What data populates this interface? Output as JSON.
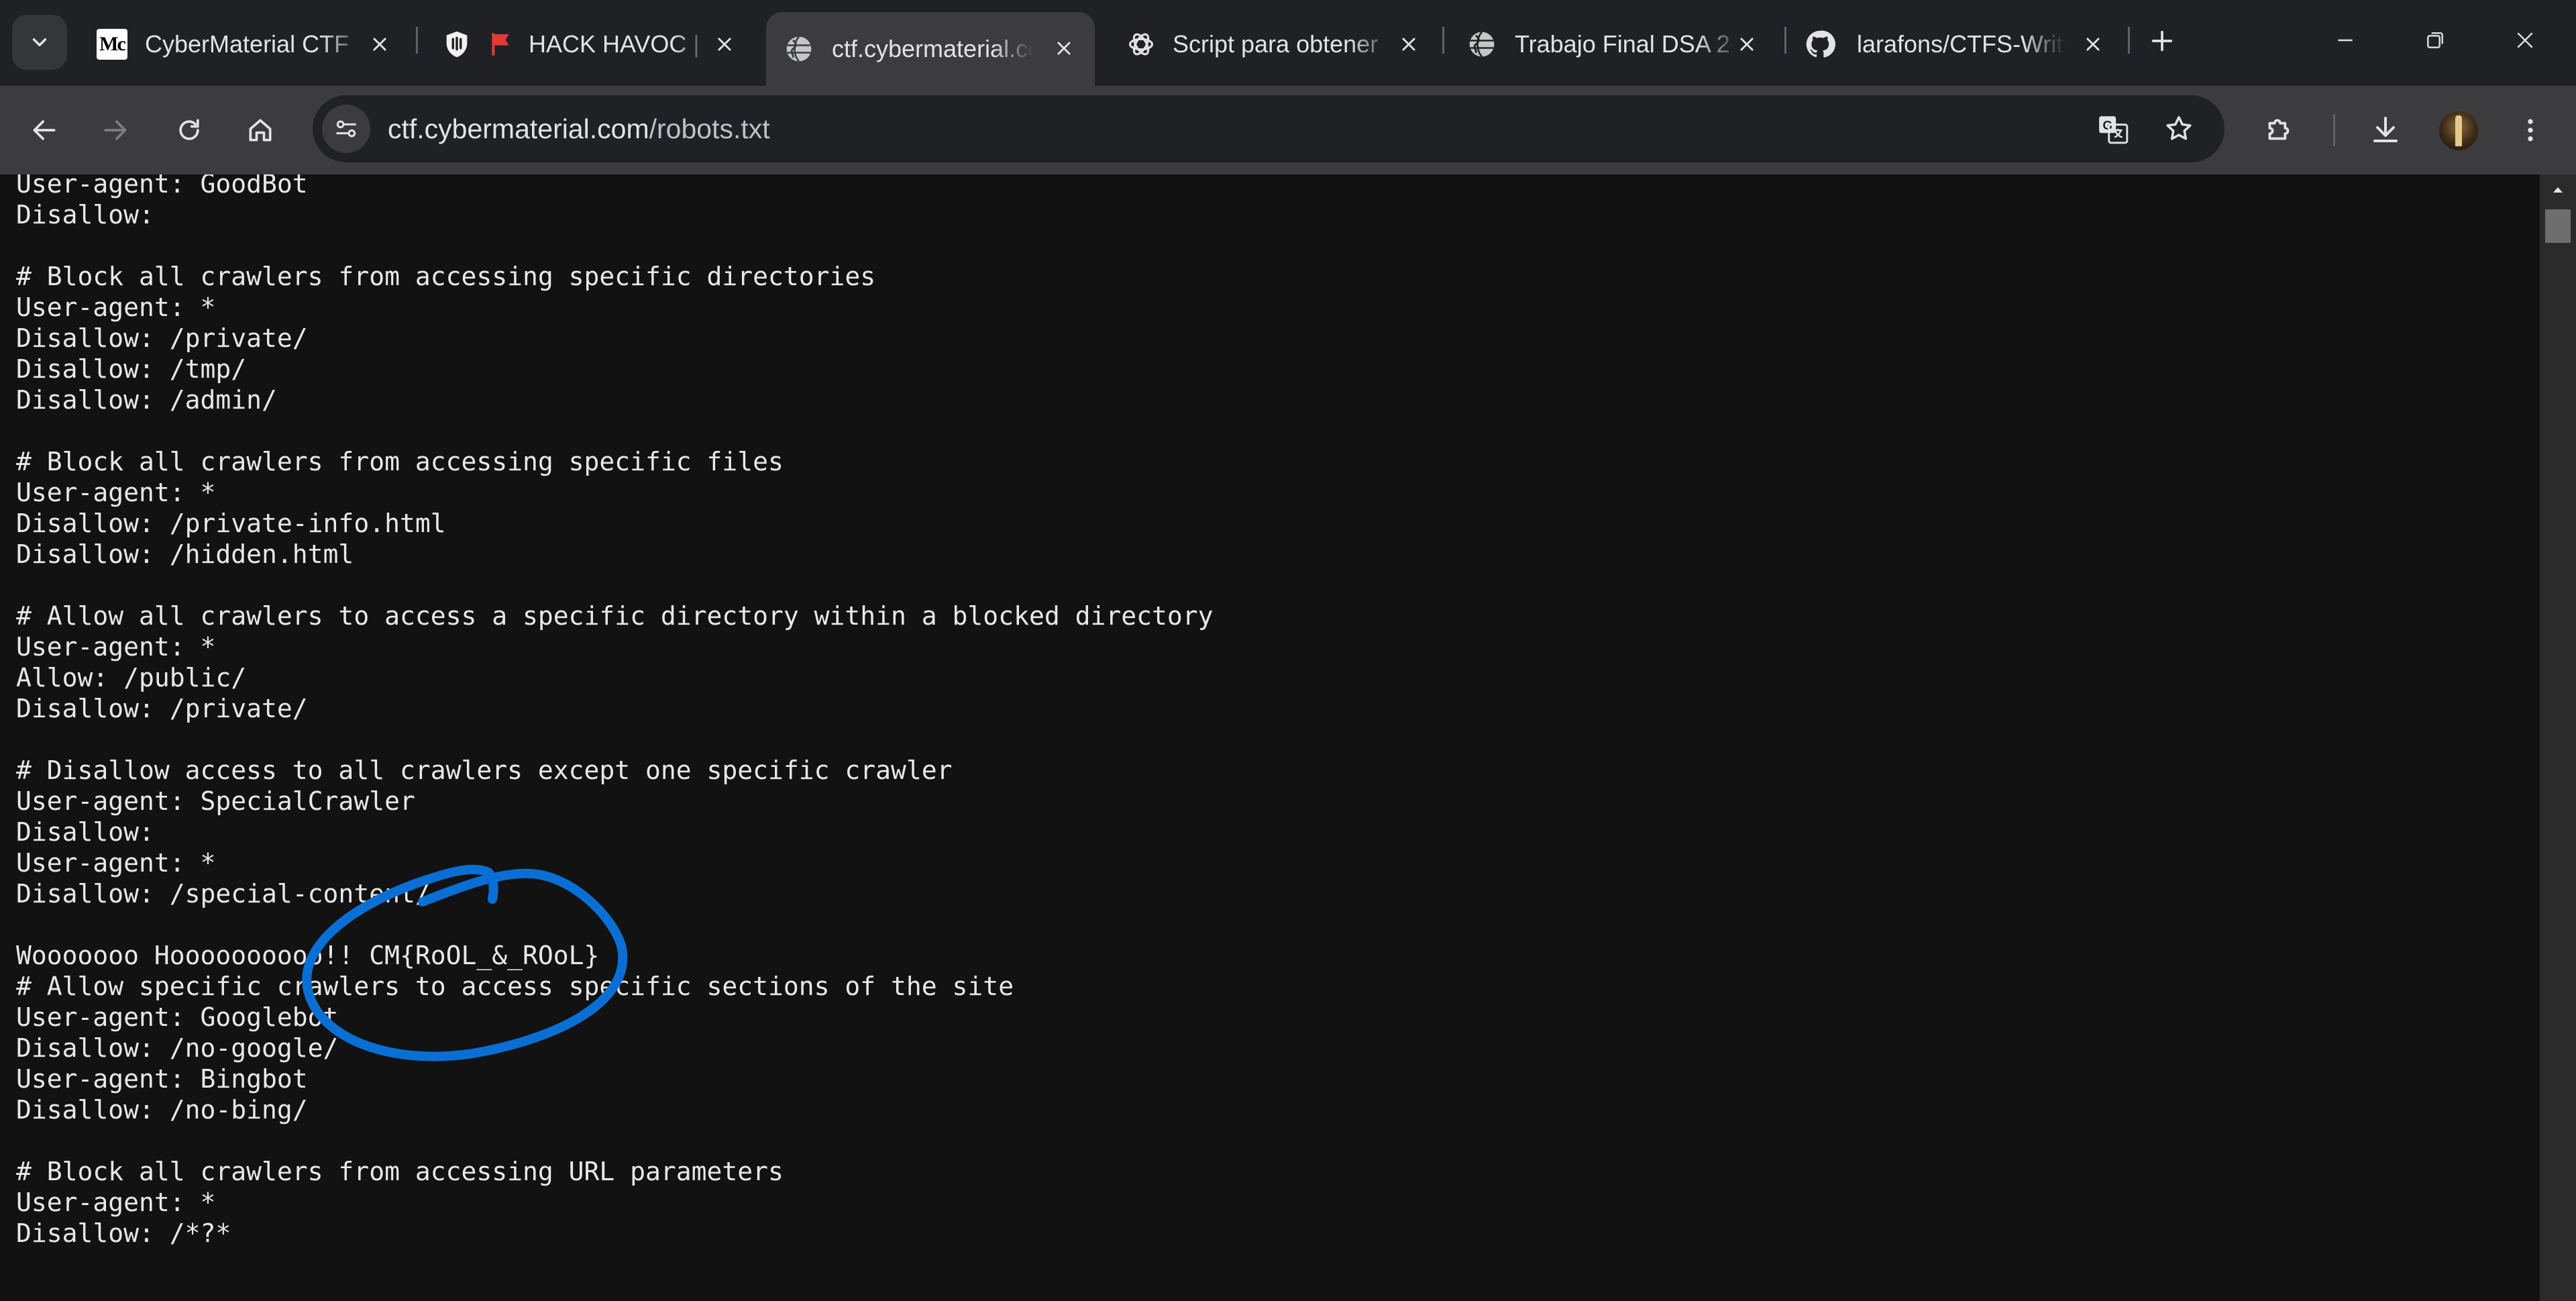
{
  "browser": {
    "tabs": [
      {
        "title": "CyberMaterial CTF",
        "favicon": "cybermaterial-logo-icon",
        "active": false
      },
      {
        "title": "HACK HAVOC |",
        "favicon": "hack-havoc-flag-icon",
        "active": false
      },
      {
        "title": "ctf.cybermaterial.com",
        "favicon": "globe-icon",
        "active": true
      },
      {
        "title": "Script para obtener",
        "favicon": "openai-logo-icon",
        "active": false
      },
      {
        "title": "Trabajo Final DSA 2",
        "favicon": "globe-icon",
        "active": false
      },
      {
        "title": "larafons/CTFS-Writeups",
        "favicon": "github-logo-icon",
        "active": false
      }
    ],
    "favicon_text": {
      "cybermaterial": "Mc"
    },
    "address_bar": {
      "host": "ctf.cybermaterial.com",
      "path": "/robots.txt"
    },
    "colors": {
      "tabstrip_bg": "#202124",
      "toolbar_bg": "#3c3c3f",
      "page_bg": "#121212",
      "annotation_stroke": "#0a6fd4",
      "flag_red": "#e53935"
    }
  },
  "page": {
    "lines": [
      "User-agent: GoodBot",
      "Disallow:",
      "",
      "# Block all crawlers from accessing specific directories",
      "User-agent: *",
      "Disallow: /private/",
      "Disallow: /tmp/",
      "Disallow: /admin/",
      "",
      "# Block all crawlers from accessing specific files",
      "User-agent: *",
      "Disallow: /private-info.html",
      "Disallow: /hidden.html",
      "",
      "# Allow all crawlers to access a specific directory within a blocked directory",
      "User-agent: *",
      "Allow: /public/",
      "Disallow: /private/",
      "",
      "# Disallow access to all crawlers except one specific crawler",
      "User-agent: SpecialCrawler",
      "Disallow:",
      "User-agent: *",
      "Disallow: /special-content/",
      "",
      "Wooooooo Hoooooooooo!! CM{RoOL_&_ROoL}",
      "# Allow specific crawlers to access specific sections of the site",
      "User-agent: Googlebot",
      "Disallow: /no-google/",
      "User-agent: Bingbot",
      "Disallow: /no-bing/",
      "",
      "# Block all crawlers from accessing URL parameters",
      "User-agent: *",
      "Disallow: /*?*"
    ]
  }
}
